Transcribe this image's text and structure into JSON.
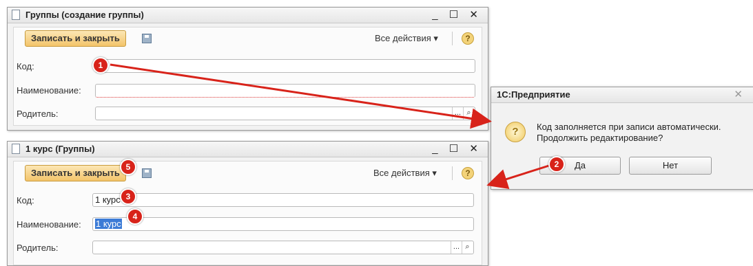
{
  "window1": {
    "title": "Группы (создание группы)",
    "save_button": "Записать и закрыть",
    "all_actions": "Все действия ▾",
    "help": "?",
    "controls": {
      "minimize": "_",
      "maximize": "☐",
      "close": "✕"
    },
    "fields": [
      {
        "label": "Код:",
        "value": ""
      },
      {
        "label": "Наименование:",
        "value": ""
      },
      {
        "label": "Родитель:",
        "value": ""
      }
    ],
    "picker": "...",
    "search_icon": "magnifier-icon"
  },
  "window2": {
    "title": "1 курс (Группы)",
    "save_button": "Записать и закрыть",
    "all_actions": "Все действия ▾",
    "help": "?",
    "controls": {
      "minimize": "_",
      "maximize": "☐",
      "close": "✕"
    },
    "fields": [
      {
        "label": "Код:",
        "value": "1 курс"
      },
      {
        "label": "Наименование:",
        "value": "1 курс"
      },
      {
        "label": "Родитель:",
        "value": ""
      }
    ],
    "picker": "..."
  },
  "dialog": {
    "title": "1С:Предприятие",
    "close": "✕",
    "message_line1": "Код заполняется при записи автоматически.",
    "message_line2": "Продолжить редактирование?",
    "icon": "question-icon",
    "yes": "Да",
    "no": "Нет"
  },
  "badges": [
    "1",
    "2",
    "3",
    "4",
    "5"
  ],
  "colors": {
    "badge": "#d8231a",
    "arrow": "#d8231a",
    "save_button": "#f3c46a",
    "selection": "#3c7bd6"
  }
}
